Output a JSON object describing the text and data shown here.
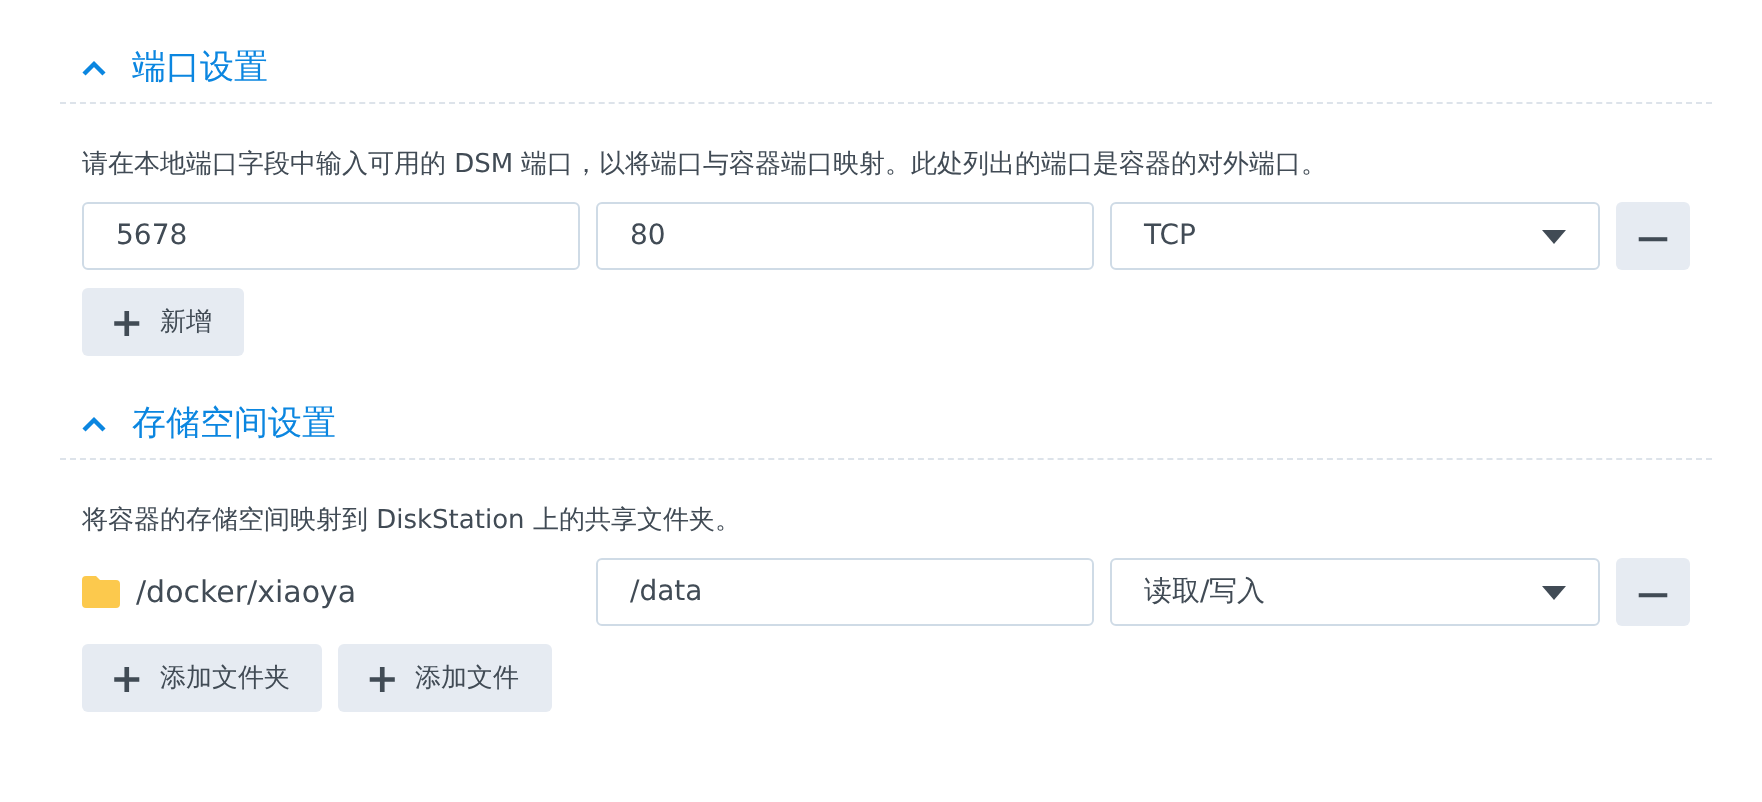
{
  "sections": [
    {
      "title": "端口设置",
      "expanded": true,
      "description": "请在本地端口字段中输入可用的 DSM 端口，以将端口与容器端口映射。此处列出的端口是容器的对外端口。",
      "rows": [
        {
          "cells": [
            {
              "kind": "input",
              "value": "5678"
            },
            {
              "kind": "input",
              "value": "80"
            },
            {
              "kind": "select",
              "value": "TCP"
            }
          ],
          "remove": "—"
        }
      ],
      "add_buttons": [
        {
          "icon": "+",
          "label": "新增"
        }
      ]
    },
    {
      "title": "存储空间设置",
      "expanded": true,
      "description": "将容器的存储空间映射到 DiskStation 上的共享文件夹。",
      "rows": [
        {
          "cells": [
            {
              "kind": "folder",
              "value": "/docker/xiaoya"
            },
            {
              "kind": "input",
              "value": "/data"
            },
            {
              "kind": "select",
              "value": "读取/写入"
            }
          ],
          "remove": "—"
        }
      ],
      "add_buttons": [
        {
          "icon": "+",
          "label": "添加文件夹"
        },
        {
          "icon": "+",
          "label": "添加文件"
        }
      ]
    }
  ]
}
